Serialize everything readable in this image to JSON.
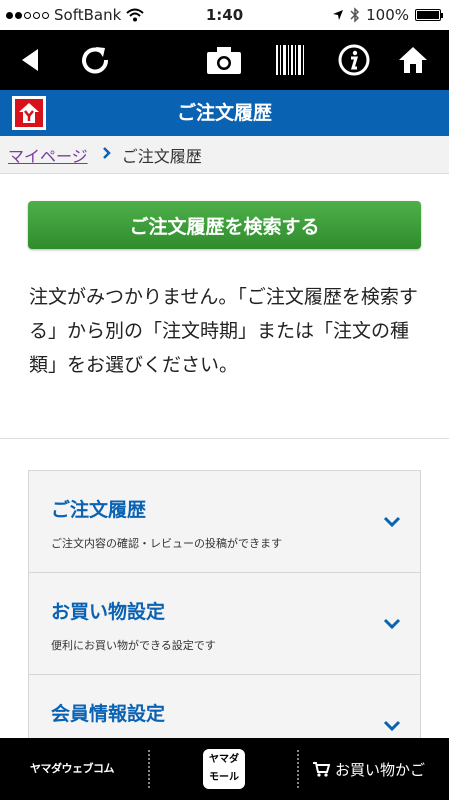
{
  "status_bar": {
    "carrier": "SoftBank",
    "time": "1:40",
    "battery": "100%",
    "battery_level": 1.0,
    "signal_bars": 2
  },
  "toolbar": {
    "icons": [
      "back-icon",
      "reload-icon",
      "camera-icon",
      "barcode-icon",
      "info-icon",
      "home-icon"
    ]
  },
  "header": {
    "title": "ご注文履歴",
    "logo": "yamada-logo",
    "color": "#0a62b3"
  },
  "breadcrumb": {
    "link": "マイページ",
    "current": "ご注文履歴"
  },
  "search_button": {
    "label": "ご注文履歴を検索する",
    "color": "#3a9a36"
  },
  "message": "注文がみつかりません。「ご注文履歴を検索する」から別の「注文時期」または「注文の種類」をお選びください。",
  "menu": {
    "items": [
      {
        "title": "ご注文履歴",
        "desc": "ご注文内容の確認・レビューの投稿ができます"
      },
      {
        "title": "お買い物設定",
        "desc": "便利にお買い物ができる設定です"
      },
      {
        "title": "会員情報設定",
        "desc": ""
      }
    ]
  },
  "bottom_bar": {
    "brand": "ヤマダウェブコム",
    "mall_line1": "ヤマダ",
    "mall_line2": "モール",
    "cart_label": "お買い物かご"
  }
}
